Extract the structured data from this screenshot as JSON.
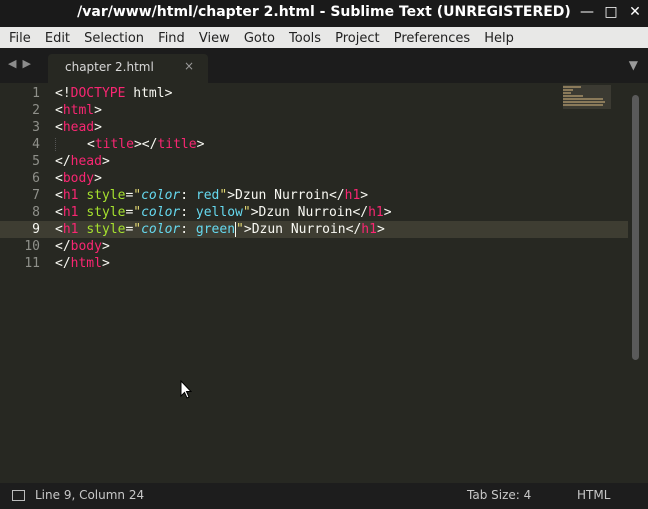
{
  "window": {
    "title": "/var/www/html/chapter 2.html - Sublime Text (UNREGISTERED)"
  },
  "menu": [
    "File",
    "Edit",
    "Selection",
    "Find",
    "View",
    "Goto",
    "Tools",
    "Project",
    "Preferences",
    "Help"
  ],
  "tab": {
    "label": "chapter 2.html",
    "close": "×"
  },
  "editor": {
    "line_numbers": [
      "1",
      "2",
      "3",
      "4",
      "5",
      "6",
      "7",
      "8",
      "9",
      "10",
      "11"
    ],
    "current_line": 9,
    "lines": [
      "<!DOCTYPE html>",
      "<html>",
      "<head>",
      "    <title></title>",
      "</head>",
      "<body>",
      "<h1 style=\"color: red\">Dzun Nurroin</h1>",
      "<h1 style=\"color: yellow\">Dzun Nurroin</h1>",
      "<h1 style=\"color: green\">Dzun Nurroin</h1>",
      "</body>",
      "</html>"
    ]
  },
  "status": {
    "position": "Line 9, Column 24",
    "tab_size": "Tab Size: 4",
    "syntax": "HTML"
  },
  "colors": {
    "editor_bg": "#272822",
    "tag": "#f92672",
    "attribute": "#a6e22e",
    "string": "#e6db74",
    "keyword_value": "#66d9ef"
  }
}
